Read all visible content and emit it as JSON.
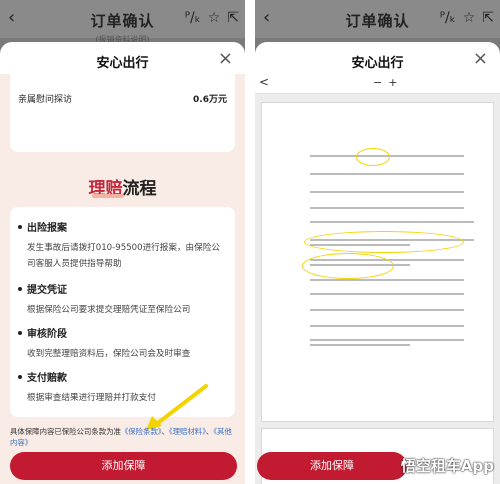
{
  "left": {
    "header": {
      "title": "订单确认",
      "icons": [
        "back-icon",
        "font-size-icon",
        "star-icon",
        "share-icon"
      ],
      "sub": "(报销资料说明)"
    },
    "sheet": {
      "title": "安心出行",
      "close": "×",
      "coverage_row": {
        "label": "亲属慰问探访",
        "value": "0.6万元"
      },
      "claims_title_a": "理赔",
      "claims_title_b": "流程",
      "steps": [
        {
          "title": "出险报案",
          "desc": "发生事故后请拨打010-95500进行报案，由保险公司客服人员提供指导帮助"
        },
        {
          "title": "提交凭证",
          "desc": "根据保险公司要求提交理赔凭证至保险公司"
        },
        {
          "title": "审核阶段",
          "desc": "收到完整理赔资料后，保险公司会及时审查"
        },
        {
          "title": "支付赔款",
          "desc": "根据审查结果进行理赔并打款支付"
        }
      ],
      "note_prefix": "具体保障内容已保险公司条款为准",
      "links": [
        "《保险条款》",
        "《理赔材料》",
        "《其他内容》"
      ],
      "note_sep": "、",
      "button": "添加保障"
    }
  },
  "right": {
    "header": {
      "title": "订单确认",
      "icons": [
        "back-icon",
        "font-size-icon",
        "star-icon",
        "share-icon"
      ]
    },
    "sheet": {
      "title": "安心出行",
      "close": "×",
      "pdf_toolbar": {
        "back": "<",
        "zoom_out": "−",
        "zoom_in": "+"
      },
      "button": "添加保障",
      "brand": "悟空租车App"
    }
  },
  "colors": {
    "accent": "#c21a30",
    "link": "#3a6fc4",
    "highlight": "#f4d400"
  }
}
